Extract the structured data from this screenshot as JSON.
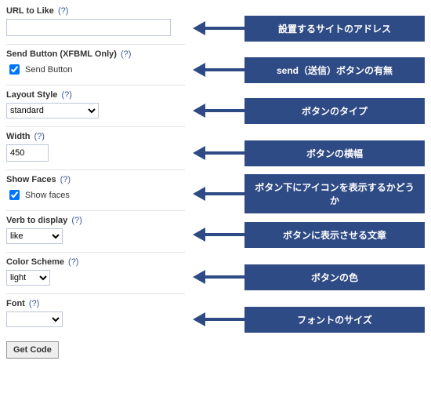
{
  "help_text": "(?)",
  "form": {
    "url": {
      "label": "URL to Like",
      "value": ""
    },
    "send": {
      "label": "Send Button (XFBML Only)",
      "checkbox_label": "Send Button",
      "checked": true
    },
    "layout": {
      "label": "Layout Style",
      "value": "standard"
    },
    "width": {
      "label": "Width",
      "value": "450"
    },
    "faces": {
      "label": "Show Faces",
      "checkbox_label": "Show faces",
      "checked": true
    },
    "verb": {
      "label": "Verb to display",
      "value": "like"
    },
    "color": {
      "label": "Color Scheme",
      "value": "light"
    },
    "font": {
      "label": "Font",
      "value": ""
    },
    "getcode": "Get Code"
  },
  "annotations": {
    "url": "設置するサイトのアドレス",
    "send": "send（送信）ボタンの有無",
    "layout": "ボタンのタイプ",
    "width": "ボタンの横幅",
    "faces": "ボタン下にアイコンを表示するかどうか",
    "verb": "ボタンに表示させる文章",
    "color": "ボタンの色",
    "font": "フォントのサイズ"
  },
  "layout_heights": {
    "url": 56,
    "send": 50,
    "layout": 54,
    "width": 54,
    "faces": 50,
    "verb": 54,
    "color": 54,
    "font": 54
  }
}
